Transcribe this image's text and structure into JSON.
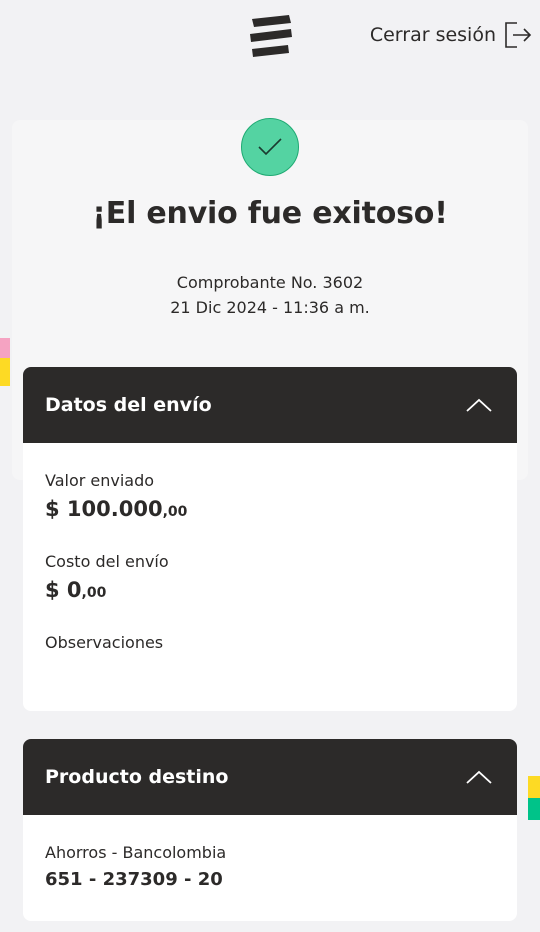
{
  "header": {
    "logo_icon": "bancolombia-logo-icon",
    "logout_label": "Cerrar sesión",
    "logout_icon": "logout-arrow-icon"
  },
  "success": {
    "icon": "check-icon",
    "title": "¡El envio fue exitoso!",
    "receipt_label": "Comprobante No. 3602",
    "datetime": "21 Dic 2024 - 11:36 a m."
  },
  "datos_envio": {
    "title": "Datos del envío",
    "chevron_icon": "chevron-up-icon",
    "valor_label": "Valor enviado",
    "valor_amount": "$ 100.000",
    "valor_cents": ",00",
    "costo_label": "Costo del envío",
    "costo_amount": "$ 0",
    "costo_cents": ",00",
    "observaciones_label": "Observaciones"
  },
  "producto_destino": {
    "title": "Producto destino",
    "chevron_icon": "chevron-up-icon",
    "account_type": "Ahorros - Bancolombia",
    "account_number": "651 - 237309 - 20"
  },
  "colors": {
    "dark": "#2c2a29",
    "success_green": "#54d3a2",
    "brand_yellow": "#fdda24",
    "brand_pink": "#f5a3c2",
    "brand_green": "#00c389",
    "background": "#f2f2f4"
  }
}
